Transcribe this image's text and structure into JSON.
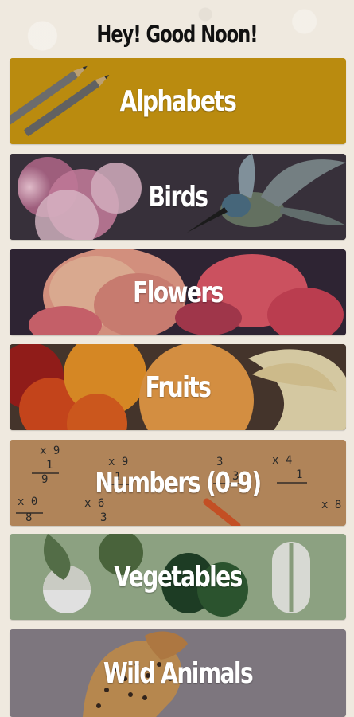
{
  "header": {
    "greeting": "Hey! Good Noon!"
  },
  "categories": [
    {
      "label": "Alphabets",
      "icon": "pencils-icon",
      "accent": "#d8a111"
    },
    {
      "label": "Birds",
      "icon": "hummingbird-icon",
      "accent": "#4a3e46"
    },
    {
      "label": "Flowers",
      "icon": "flower-icon",
      "accent": "#3b2c3f"
    },
    {
      "label": "Fruits",
      "icon": "fruit-icon",
      "accent": "#5d4236"
    },
    {
      "label": "Numbers (0-9)",
      "icon": "math-notes-icon",
      "accent": "#c99563"
    },
    {
      "label": "Vegetables",
      "icon": "vegetable-icon",
      "accent": "#9eb590"
    },
    {
      "label": "Wild Animals",
      "icon": "leopard-icon",
      "accent": "#8e8690"
    }
  ],
  "colors": {
    "background": "#efe9df",
    "title": "#111111",
    "card_text": "#ffffff"
  }
}
